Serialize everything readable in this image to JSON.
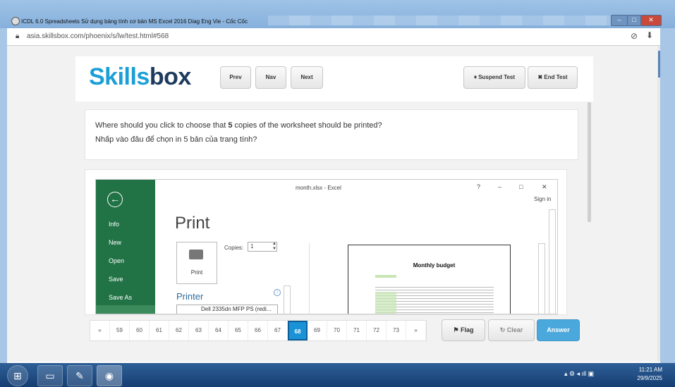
{
  "window": {
    "title": "ICDL 6.0 Spreadsheets Sử dụng bảng tính cơ bản MS Excel 2016 Diag Eng Vie - Cốc Cốc",
    "url": "asia.skillsbox.com/phoenix/s/lw/test.html#568",
    "minimize": "–",
    "maximize": "□",
    "close": "✕"
  },
  "header": {
    "logo_part1": "Skills",
    "logo_part2": "box",
    "prev": "Prev",
    "nav": "Nav",
    "next": "Next",
    "suspend": "Suspend Test",
    "end": "End Test"
  },
  "question": {
    "pre": "Where should you click to choose that ",
    "bold": "5",
    "post": " copies of the worksheet should be printed?",
    "vi": "Nhấp vào đâu để chọn in 5 bản của trang tính?"
  },
  "excel": {
    "title": "month.xlsx - Excel",
    "help": "?",
    "min": "–",
    "restore": "□",
    "close": "✕",
    "signin": "Sign in",
    "nav": [
      "Info",
      "New",
      "Open",
      "Save",
      "Save As"
    ],
    "print_heading": "Print",
    "print_button": "Print",
    "copies_label": "Copies:",
    "copies_value": "1",
    "printer_heading": "Printer",
    "printer_name": "Dell 2335dn MFP PS (redi...",
    "preview_title": "Monthly budget"
  },
  "pager": {
    "first": "«",
    "last": "»",
    "pages": [
      "59",
      "60",
      "61",
      "62",
      "63",
      "64",
      "65",
      "66",
      "67",
      "68",
      "69",
      "70",
      "71",
      "72",
      "73"
    ],
    "active": "68"
  },
  "actions": {
    "flag": "Flag",
    "clear": "Clear",
    "answer": "Answer"
  },
  "taskbar": {
    "time": "11:21 AM",
    "date": "29/9/2025"
  },
  "colors": {
    "excel_green": "#217346",
    "logo_blue": "#1b9fd6",
    "logo_navy": "#1d3b5e",
    "active_page": "#1a93d6",
    "answer_btn": "#4aa8dd"
  }
}
